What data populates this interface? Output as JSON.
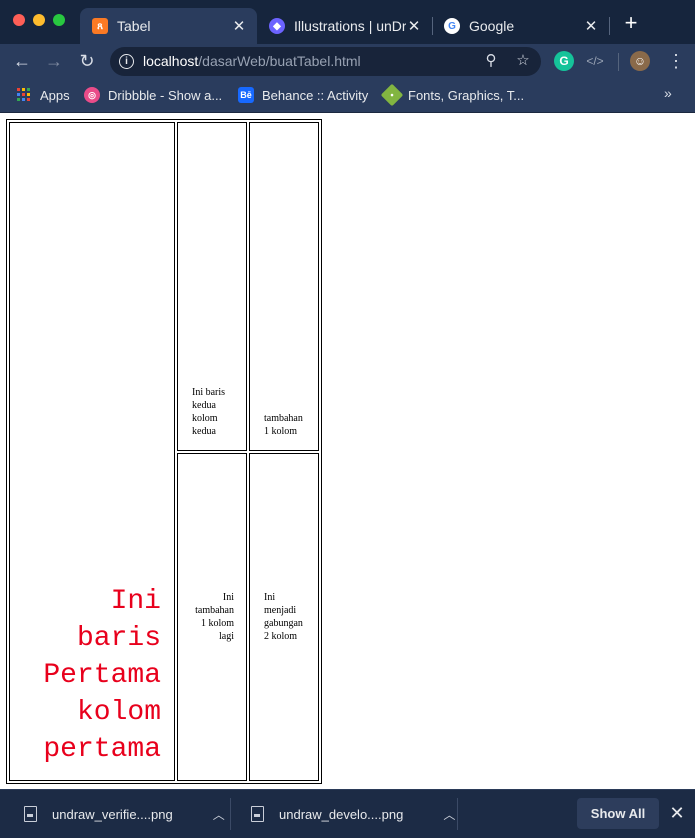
{
  "tabs": [
    {
      "title": "Tabel",
      "icon": "xampp-icon",
      "color": "#fb7a24"
    },
    {
      "title": "Illustrations | unDraw",
      "icon": "undraw-icon",
      "color": "#6c63ff"
    },
    {
      "title": "Google",
      "icon": "google-icon",
      "color": "#4285f4"
    }
  ],
  "toolbar": {
    "url_host": "localhost",
    "url_path": "/dasarWeb/buatTabel.html"
  },
  "bookmarks": [
    {
      "label": "Apps",
      "icon": "apps-grid-icon"
    },
    {
      "label": "Dribbble - Show a...",
      "icon": "dribbble-icon"
    },
    {
      "label": "Behance :: Activity",
      "icon": "behance-icon"
    },
    {
      "label": "Fonts, Graphics, T...",
      "icon": "tag-icon"
    }
  ],
  "table": {
    "big_cell_text": "Ini baris Pertama kolom pertama",
    "big_cell_color": "#e8001c",
    "cell_r1c2": "Ini baris kedua kolom kedua",
    "cell_r1c3": "tambahan 1 kolom",
    "cell_r2c2": "Ini tambahan 1 kolom lagi",
    "cell_r2c3": "Ini menjadi gabungan 2 kolom"
  },
  "downloads": [
    {
      "file": "undraw_verifie....png"
    },
    {
      "file": "undraw_develo....png"
    }
  ],
  "shelf": {
    "show_all": "Show All"
  }
}
